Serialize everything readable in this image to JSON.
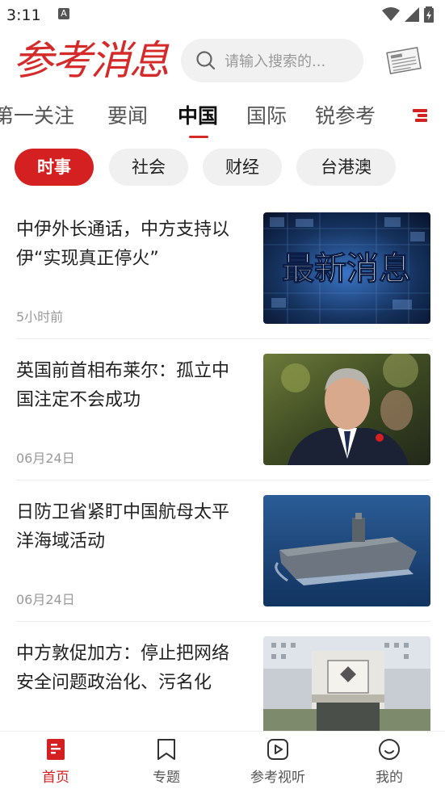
{
  "status": {
    "time": "3:11",
    "notif": "A"
  },
  "header": {
    "logo": "参考消息",
    "search_placeholder": "请输入搜索的..."
  },
  "tabs": [
    "第一关注",
    "要闻",
    "中国",
    "国际",
    "锐参考"
  ],
  "active_tab": "中国",
  "chips": [
    "时事",
    "社会",
    "财经",
    "台港澳"
  ],
  "news": [
    {
      "title": "中伊外长通话，中方支持以伊“实现真正停火”",
      "date": "5小时前",
      "thumb_text": "最新消息"
    },
    {
      "title": "英国前首相布莱尔：孤立中国注定不会成功",
      "date": "06月24日"
    },
    {
      "title": "日防卫省紧盯中国航母太平洋海域活动",
      "date": "06月24日"
    },
    {
      "title": "中方敦促加方：停止把网络安全问题政治化、污名化",
      "date": ""
    }
  ],
  "nav": [
    {
      "label": "首页"
    },
    {
      "label": "专题"
    },
    {
      "label": "参考视听"
    },
    {
      "label": "我的"
    }
  ],
  "colors": {
    "accent": "#d42020"
  }
}
